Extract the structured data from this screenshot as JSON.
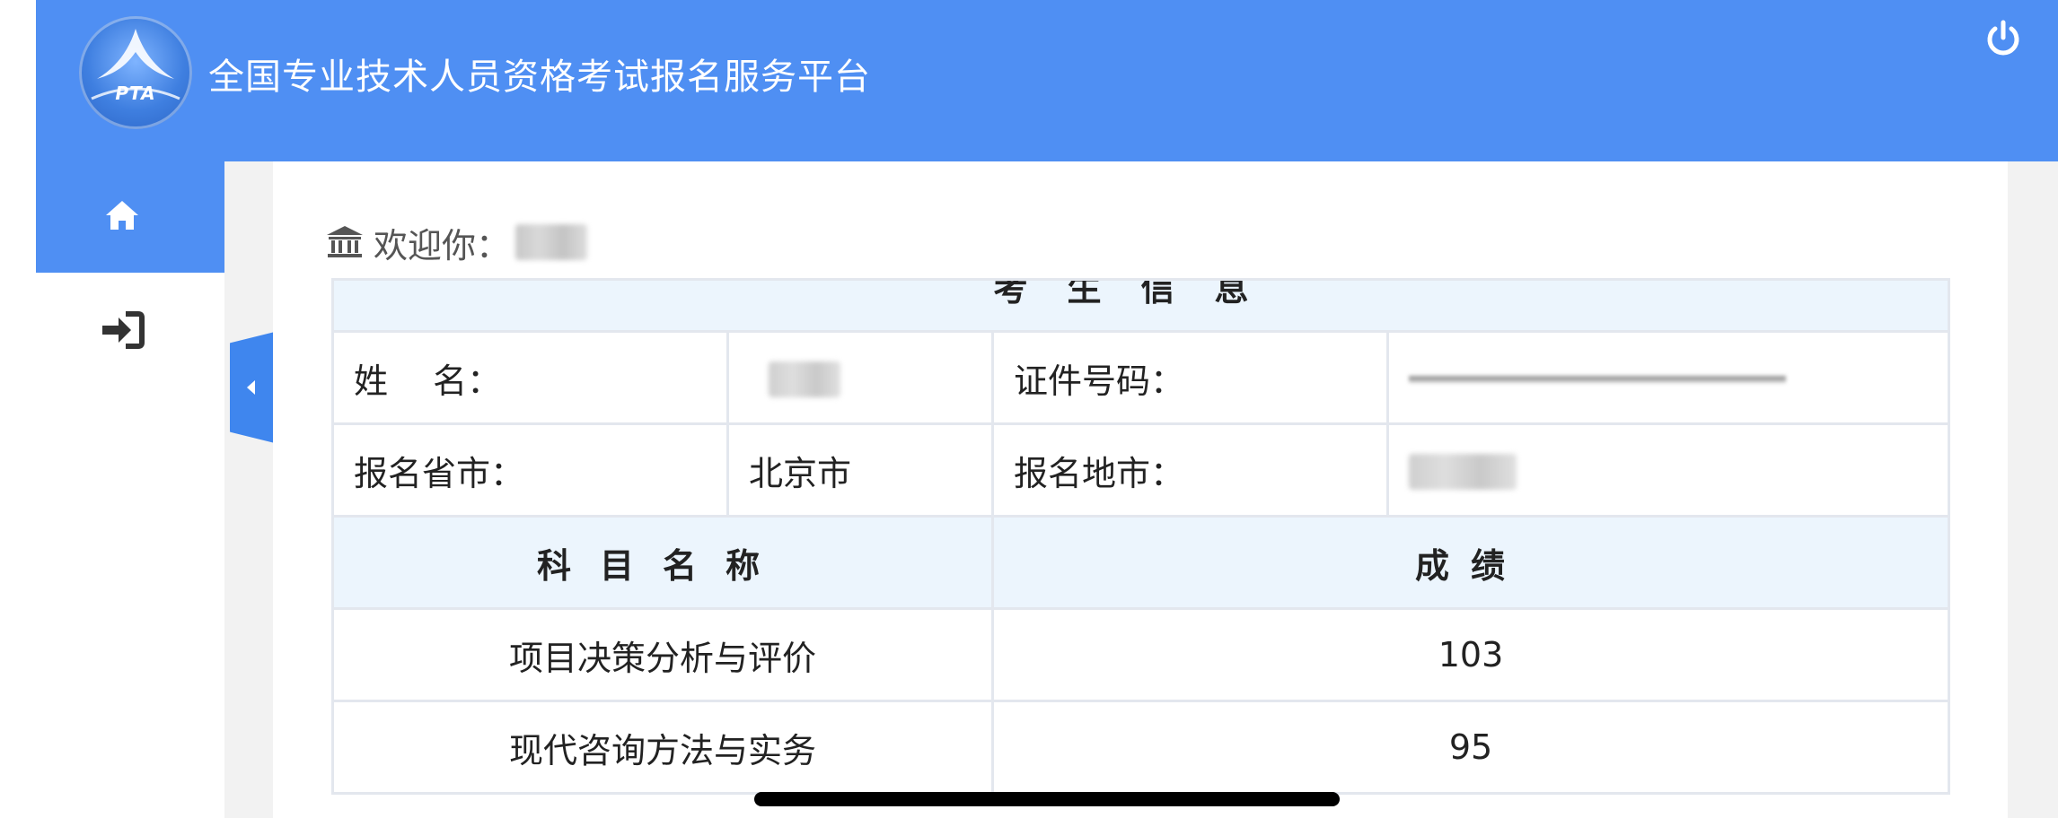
{
  "header": {
    "logo_text": "PTA",
    "title": "全国专业技术人员资格考试报名服务平台",
    "power_icon": "power-icon"
  },
  "sidebar": {
    "items": [
      {
        "icon": "home-icon",
        "active": true
      },
      {
        "icon": "sign-in-icon",
        "active": false
      }
    ]
  },
  "colors": {
    "accent": "#4f8ff3",
    "table_head_bg": "#ecf5fd",
    "content_bg": "#f2f2f2"
  },
  "welcome": {
    "icon": "bank-icon",
    "text": "欢迎你："
  },
  "info": {
    "section_title": "考生信息",
    "name_label": "姓　 名：",
    "id_label": "证件号码：",
    "province_label": "报名省市：",
    "province_value": "北京市",
    "city_label": "报名地市："
  },
  "scores": {
    "headers": {
      "subject": "科目名称",
      "score": "成绩"
    },
    "rows": [
      {
        "subject": "项目决策分析与评价",
        "score": "103"
      },
      {
        "subject": "现代咨询方法与实务",
        "score": "95"
      }
    ]
  }
}
